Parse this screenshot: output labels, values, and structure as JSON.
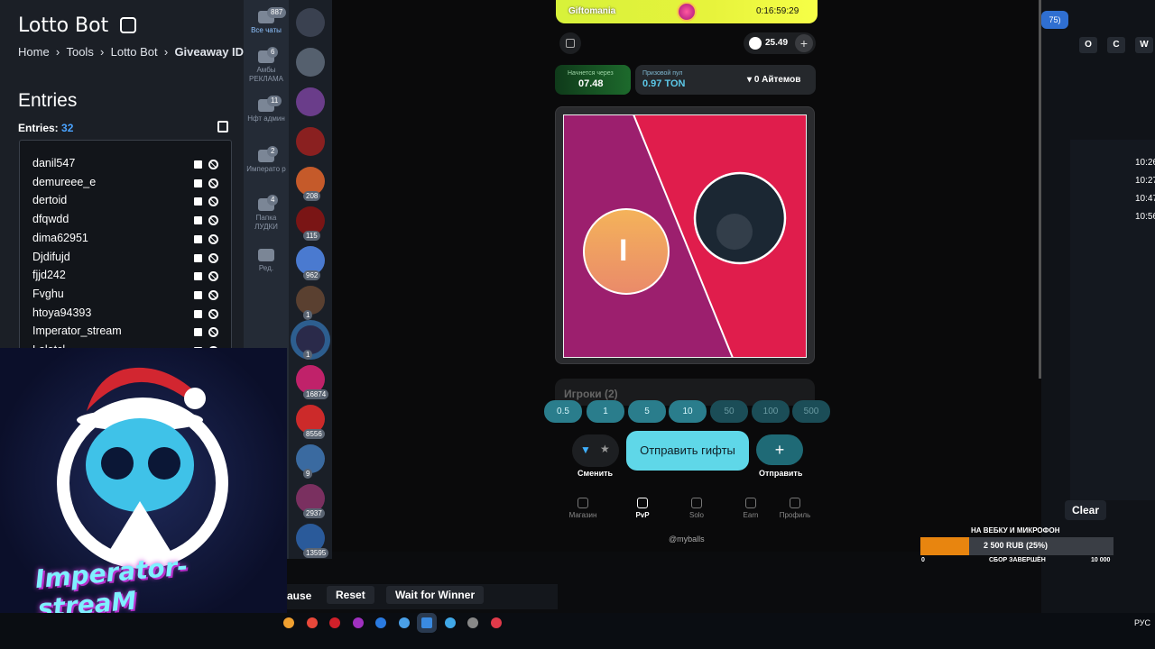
{
  "lotto": {
    "title": "Lotto Bot",
    "breadcrumb": [
      "Home",
      "Tools",
      "Lotto Bot",
      "Giveaway ID"
    ],
    "entries_heading": "Entries",
    "entries_label": "Entries:",
    "entries_count": "32",
    "entries": [
      "danil547",
      "demureee_e",
      "dertoid",
      "dfqwdd",
      "dima62951",
      "Djdifujd",
      "fjjd242",
      "Fvghu",
      "htoya94393",
      "Imperator_stream",
      "Lolotcl"
    ]
  },
  "controls": {
    "pause": "ause",
    "reset": "Reset",
    "wait": "Wait for Winner"
  },
  "folders": [
    {
      "label": "Все чаты",
      "badge": "887"
    },
    {
      "label": "Амбы РЕКЛАМА",
      "badge": "6"
    },
    {
      "label": "Нфт админ",
      "badge": "11"
    },
    {
      "label": "Императо р",
      "badge": "2"
    },
    {
      "label": "Папка ЛУДКИ",
      "badge": "4"
    },
    {
      "label": "Ред.",
      "badge": ""
    }
  ],
  "chat_badges": [
    "",
    "",
    "",
    "",
    "208",
    "115",
    "962",
    "1",
    "1",
    "16874",
    "8556",
    "9",
    "2937",
    "13595"
  ],
  "app": {
    "banner_name": "Giftomania",
    "banner_timer": "0:16:59:29",
    "balance": "25.49",
    "starts_in_label": "Начнется через",
    "starts_in_value": "07.48",
    "pool_label": "Призовой пул",
    "pool_value": "0.97 TON",
    "items_label": "0 Айтемов",
    "player_initial": "I",
    "players_label": "Игроки (2)",
    "amounts": [
      "0.5",
      "1",
      "5",
      "10",
      "50",
      "100",
      "500"
    ],
    "switch_label": "Сменить",
    "send_gifts": "Отправить гифты",
    "send_label": "Отправить",
    "nav": [
      "Магазин",
      "PvP",
      "Solo",
      "Earn",
      "Профиль"
    ],
    "handle": "@myballs"
  },
  "stream": {
    "logo_text": "Imperator-streaM",
    "goal_title": "НА ВЕБКУ И МИКРОФОН",
    "goal_amount": "2 500 RUB (25%)",
    "goal_progress": 0.25,
    "goal_min": "0",
    "goal_status": "СБОР ЗАВЕРШЁН",
    "goal_max": "10 000"
  },
  "right": {
    "badge": "75)",
    "letters": [
      "O",
      "C",
      "W"
    ],
    "times": [
      "10:26",
      "10:27",
      "10:47",
      "10:56"
    ],
    "clear": "Clear"
  },
  "taskbar": {
    "lang": "РУС"
  }
}
